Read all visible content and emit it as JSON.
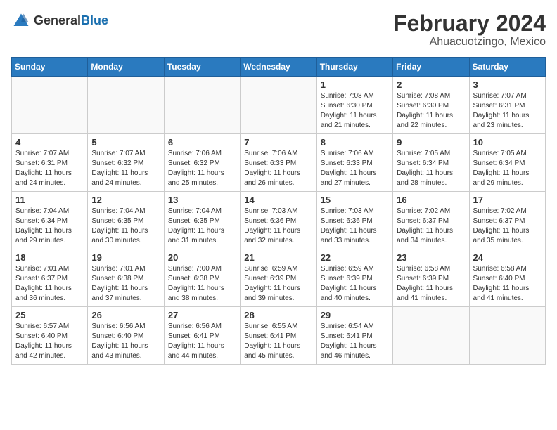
{
  "logo": {
    "general": "General",
    "blue": "Blue"
  },
  "title": {
    "month": "February 2024",
    "location": "Ahuacuotzingo, Mexico"
  },
  "headers": [
    "Sunday",
    "Monday",
    "Tuesday",
    "Wednesday",
    "Thursday",
    "Friday",
    "Saturday"
  ],
  "weeks": [
    [
      {
        "day": "",
        "info": "",
        "empty": true
      },
      {
        "day": "",
        "info": "",
        "empty": true
      },
      {
        "day": "",
        "info": "",
        "empty": true
      },
      {
        "day": "",
        "info": "",
        "empty": true
      },
      {
        "day": "1",
        "info": "Sunrise: 7:08 AM\nSunset: 6:30 PM\nDaylight: 11 hours\nand 21 minutes.",
        "empty": false
      },
      {
        "day": "2",
        "info": "Sunrise: 7:08 AM\nSunset: 6:30 PM\nDaylight: 11 hours\nand 22 minutes.",
        "empty": false
      },
      {
        "day": "3",
        "info": "Sunrise: 7:07 AM\nSunset: 6:31 PM\nDaylight: 11 hours\nand 23 minutes.",
        "empty": false
      }
    ],
    [
      {
        "day": "4",
        "info": "Sunrise: 7:07 AM\nSunset: 6:31 PM\nDaylight: 11 hours\nand 24 minutes.",
        "empty": false
      },
      {
        "day": "5",
        "info": "Sunrise: 7:07 AM\nSunset: 6:32 PM\nDaylight: 11 hours\nand 24 minutes.",
        "empty": false
      },
      {
        "day": "6",
        "info": "Sunrise: 7:06 AM\nSunset: 6:32 PM\nDaylight: 11 hours\nand 25 minutes.",
        "empty": false
      },
      {
        "day": "7",
        "info": "Sunrise: 7:06 AM\nSunset: 6:33 PM\nDaylight: 11 hours\nand 26 minutes.",
        "empty": false
      },
      {
        "day": "8",
        "info": "Sunrise: 7:06 AM\nSunset: 6:33 PM\nDaylight: 11 hours\nand 27 minutes.",
        "empty": false
      },
      {
        "day": "9",
        "info": "Sunrise: 7:05 AM\nSunset: 6:34 PM\nDaylight: 11 hours\nand 28 minutes.",
        "empty": false
      },
      {
        "day": "10",
        "info": "Sunrise: 7:05 AM\nSunset: 6:34 PM\nDaylight: 11 hours\nand 29 minutes.",
        "empty": false
      }
    ],
    [
      {
        "day": "11",
        "info": "Sunrise: 7:04 AM\nSunset: 6:34 PM\nDaylight: 11 hours\nand 29 minutes.",
        "empty": false
      },
      {
        "day": "12",
        "info": "Sunrise: 7:04 AM\nSunset: 6:35 PM\nDaylight: 11 hours\nand 30 minutes.",
        "empty": false
      },
      {
        "day": "13",
        "info": "Sunrise: 7:04 AM\nSunset: 6:35 PM\nDaylight: 11 hours\nand 31 minutes.",
        "empty": false
      },
      {
        "day": "14",
        "info": "Sunrise: 7:03 AM\nSunset: 6:36 PM\nDaylight: 11 hours\nand 32 minutes.",
        "empty": false
      },
      {
        "day": "15",
        "info": "Sunrise: 7:03 AM\nSunset: 6:36 PM\nDaylight: 11 hours\nand 33 minutes.",
        "empty": false
      },
      {
        "day": "16",
        "info": "Sunrise: 7:02 AM\nSunset: 6:37 PM\nDaylight: 11 hours\nand 34 minutes.",
        "empty": false
      },
      {
        "day": "17",
        "info": "Sunrise: 7:02 AM\nSunset: 6:37 PM\nDaylight: 11 hours\nand 35 minutes.",
        "empty": false
      }
    ],
    [
      {
        "day": "18",
        "info": "Sunrise: 7:01 AM\nSunset: 6:37 PM\nDaylight: 11 hours\nand 36 minutes.",
        "empty": false
      },
      {
        "day": "19",
        "info": "Sunrise: 7:01 AM\nSunset: 6:38 PM\nDaylight: 11 hours\nand 37 minutes.",
        "empty": false
      },
      {
        "day": "20",
        "info": "Sunrise: 7:00 AM\nSunset: 6:38 PM\nDaylight: 11 hours\nand 38 minutes.",
        "empty": false
      },
      {
        "day": "21",
        "info": "Sunrise: 6:59 AM\nSunset: 6:39 PM\nDaylight: 11 hours\nand 39 minutes.",
        "empty": false
      },
      {
        "day": "22",
        "info": "Sunrise: 6:59 AM\nSunset: 6:39 PM\nDaylight: 11 hours\nand 40 minutes.",
        "empty": false
      },
      {
        "day": "23",
        "info": "Sunrise: 6:58 AM\nSunset: 6:39 PM\nDaylight: 11 hours\nand 41 minutes.",
        "empty": false
      },
      {
        "day": "24",
        "info": "Sunrise: 6:58 AM\nSunset: 6:40 PM\nDaylight: 11 hours\nand 41 minutes.",
        "empty": false
      }
    ],
    [
      {
        "day": "25",
        "info": "Sunrise: 6:57 AM\nSunset: 6:40 PM\nDaylight: 11 hours\nand 42 minutes.",
        "empty": false
      },
      {
        "day": "26",
        "info": "Sunrise: 6:56 AM\nSunset: 6:40 PM\nDaylight: 11 hours\nand 43 minutes.",
        "empty": false
      },
      {
        "day": "27",
        "info": "Sunrise: 6:56 AM\nSunset: 6:41 PM\nDaylight: 11 hours\nand 44 minutes.",
        "empty": false
      },
      {
        "day": "28",
        "info": "Sunrise: 6:55 AM\nSunset: 6:41 PM\nDaylight: 11 hours\nand 45 minutes.",
        "empty": false
      },
      {
        "day": "29",
        "info": "Sunrise: 6:54 AM\nSunset: 6:41 PM\nDaylight: 11 hours\nand 46 minutes.",
        "empty": false
      },
      {
        "day": "",
        "info": "",
        "empty": true
      },
      {
        "day": "",
        "info": "",
        "empty": true
      }
    ]
  ]
}
